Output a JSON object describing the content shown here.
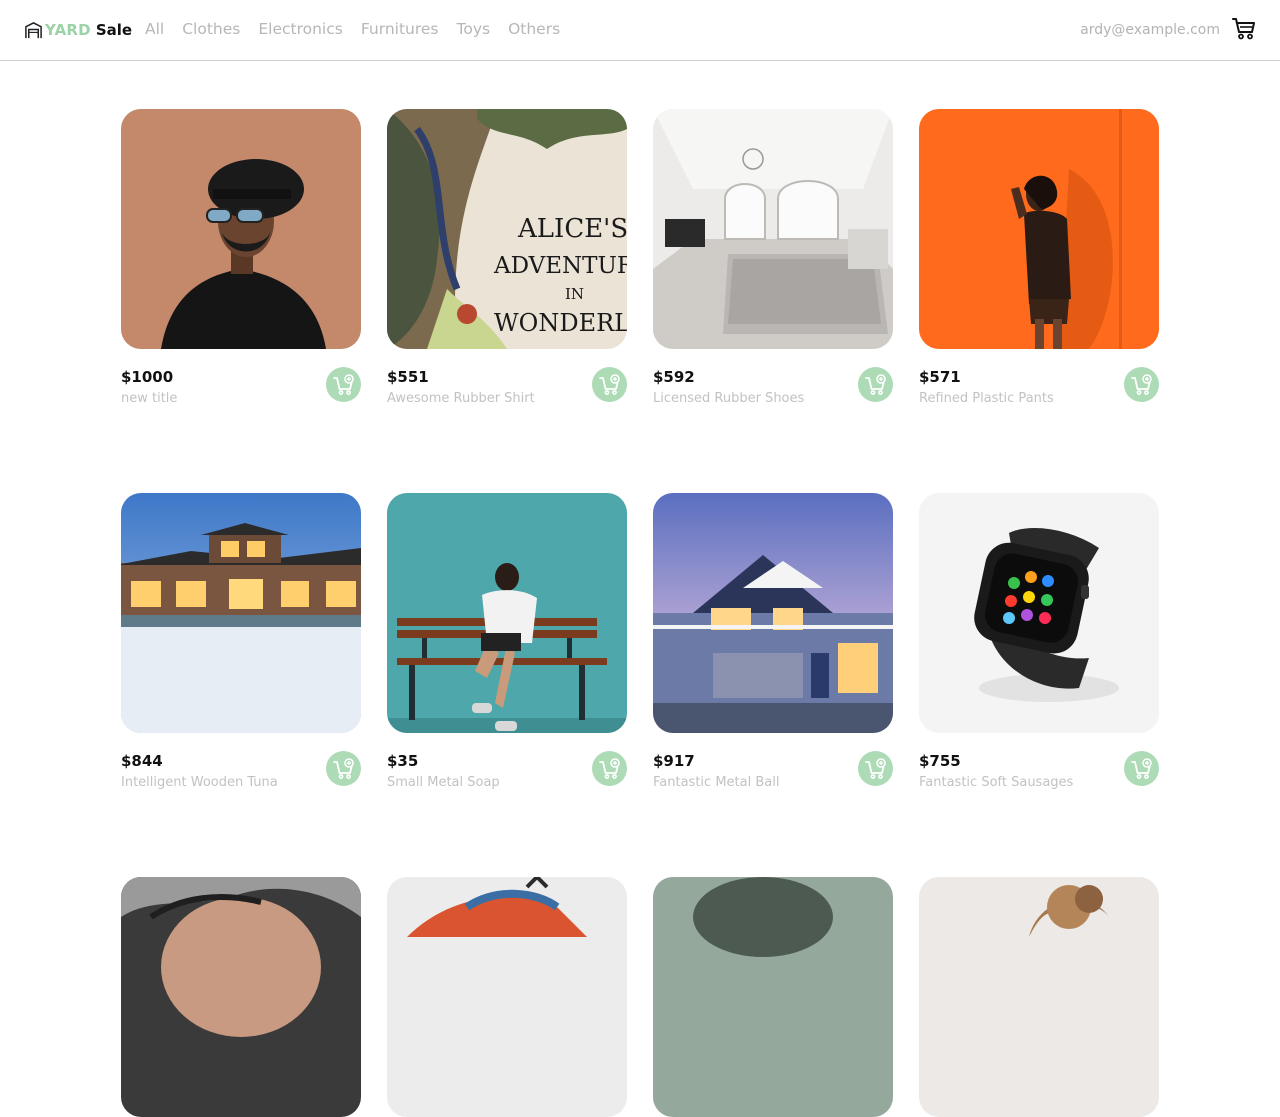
{
  "header": {
    "logo_yard": "YARD",
    "logo_sale": "Sale",
    "nav": [
      "All",
      "Clothes",
      "Electronics",
      "Furnitures",
      "Toys",
      "Others"
    ],
    "user_email": "ardy@example.com"
  },
  "colors": {
    "accent_green": "#acdbb6",
    "logo_green": "#9bd3a7",
    "muted_text": "#b7b7b7"
  },
  "products": [
    {
      "price": "$1000",
      "title": "new title",
      "image": "man-with-hat"
    },
    {
      "price": "$551",
      "title": "Awesome Rubber Shirt",
      "image": "alices-adventures-book-cover"
    },
    {
      "price": "$592",
      "title": "Licensed Rubber Shoes",
      "image": "white-bedroom"
    },
    {
      "price": "$571",
      "title": "Refined Plastic Pants",
      "image": "woman-orange-wall"
    },
    {
      "price": "$844",
      "title": "Intelligent Wooden Tuna",
      "image": "modern-house-snow"
    },
    {
      "price": "$35",
      "title": "Small Metal Soap",
      "image": "woman-on-bench"
    },
    {
      "price": "$917",
      "title": "Fantastic Metal Ball",
      "image": "blue-house-dusk"
    },
    {
      "price": "$755",
      "title": "Fantastic Soft Sausages",
      "image": "smartwatch"
    },
    {
      "price": "",
      "title": "",
      "image": "woman-portrait"
    },
    {
      "price": "",
      "title": "",
      "image": "colorful-sneaker"
    },
    {
      "price": "",
      "title": "",
      "image": "green-blur"
    },
    {
      "price": "",
      "title": "",
      "image": "curly-hair"
    }
  ],
  "book_cover_text": [
    "ALICE'S",
    "ADVENTURE",
    "IN",
    "WONDERLA"
  ],
  "icons": {
    "cart": "shopping-cart-icon",
    "add_to_cart": "add-to-cart-icon",
    "logo": "store-icon"
  }
}
